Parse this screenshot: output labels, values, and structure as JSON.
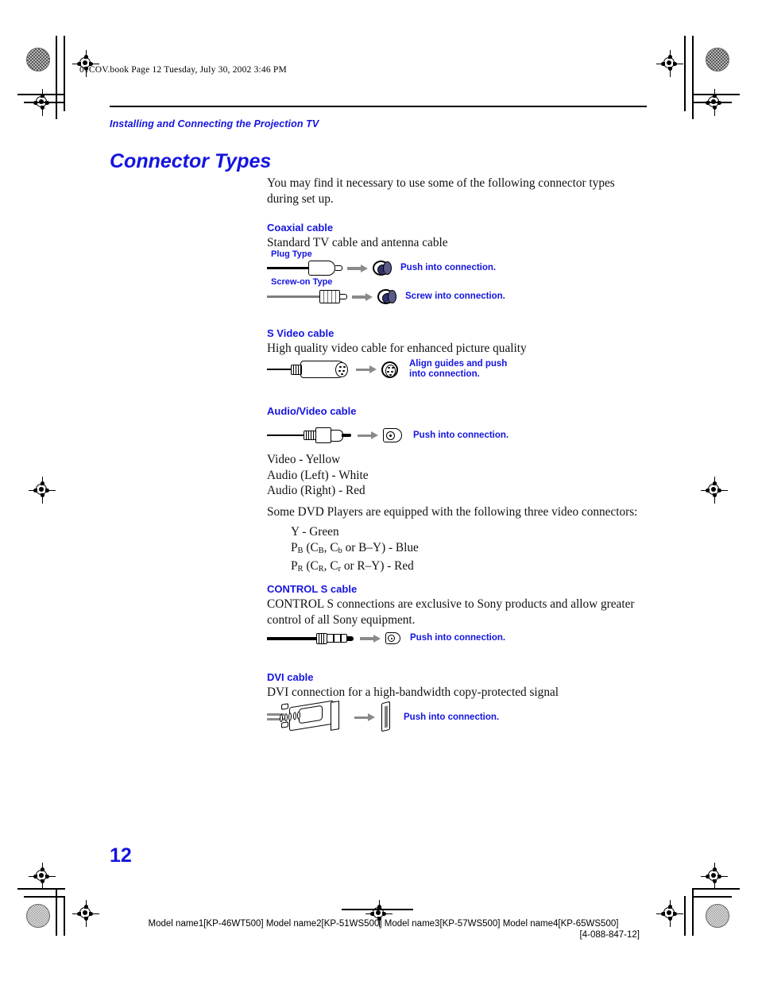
{
  "file_header": "01COV.book  Page 12  Tuesday, July 30, 2002  3:46 PM",
  "kicker": "Installing and Connecting the Projection TV",
  "title": "Connector Types",
  "intro": "You may find it necessary to use some of the following connector types during set up.",
  "page_number": "12",
  "accent_color": "#1414e0",
  "sections": [
    {
      "heading": "Coaxial cable",
      "description": "Standard TV cable and antenna cable",
      "variants": [
        {
          "label": "Plug Type",
          "callout": "Push into connection."
        },
        {
          "label": "Screw-on Type",
          "callout": "Screw into connection."
        }
      ]
    },
    {
      "heading": "S Video cable",
      "description": "High quality video cable for enhanced picture quality",
      "callout_line1": "Align guides and push",
      "callout_line2": "into connection."
    },
    {
      "heading": "Audio/Video cable",
      "description": "",
      "callout": "Push into connection.",
      "color_legend": [
        "Video - Yellow",
        "Audio (Left) - White",
        "Audio (Right) - Red"
      ],
      "component_intro": "Some DVD Players are equipped with the following three video connectors:",
      "component_list": [
        {
          "pre": "Y - Green",
          "sub": "",
          "post": ""
        },
        {
          "pre": "P",
          "sub": "B",
          "post": " (C",
          "sub2": "B",
          "post2": ", C",
          "sub3": "b",
          "post3": " or B–Y) - Blue"
        },
        {
          "pre": "P",
          "sub": "R",
          "post": " (C",
          "sub2": "R",
          "post2": ", C",
          "sub3": "r",
          "post3": " or R–Y) - Red"
        }
      ]
    },
    {
      "heading": "CONTROL S cable",
      "description": "CONTROL S connections are exclusive to Sony products and allow greater control of all Sony equipment.",
      "callout": "Push into connection."
    },
    {
      "heading": "DVI cable",
      "description": "DVI connection for a high-bandwidth copy-protected signal",
      "callout": "Push into connection."
    }
  ],
  "footer": {
    "models": "Model name1[KP-46WT500] Model name2[KP-51WS500] Model name3[KP-57WS500] Model name4[KP-65WS500]",
    "doc_number": "[4-088-847-12]"
  }
}
